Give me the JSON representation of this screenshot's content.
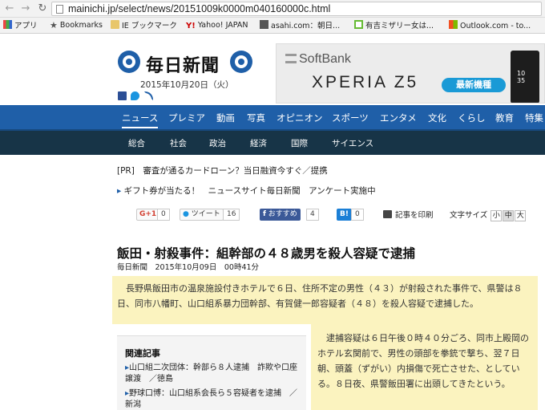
{
  "browser": {
    "url": "mainichi.jp/select/news/20151009k0000m040160000c.html",
    "bookmarks": [
      {
        "icon": "apps-icon",
        "label": "アプリ"
      },
      {
        "icon": "star-icon",
        "label": "Bookmarks"
      },
      {
        "icon": "folder-icon",
        "label": "IE ブックマーク"
      },
      {
        "icon": "yahoo-icon",
        "label": "Yahoo! JAPAN"
      },
      {
        "icon": "asahi-icon",
        "label": "asahi.com：朝日..."
      },
      {
        "icon": "green-icon",
        "label": "有吉ミザリー女は..."
      },
      {
        "icon": "microsoft-icon",
        "label": "Outlook.com - to..."
      }
    ]
  },
  "header": {
    "logo_text": "毎日新聞",
    "date": "2015年10月20日（火）"
  },
  "ad": {
    "brand": "SoftBank",
    "model": "XPERIA Z5",
    "badge": "最新機種",
    "phone_time": "10\n35"
  },
  "nav_primary": [
    "ニュース",
    "プレミア",
    "動画",
    "写真",
    "オピニオン",
    "スポーツ",
    "エンタメ",
    "文化",
    "くらし",
    "教育",
    "特集"
  ],
  "nav_secondary": [
    "総合",
    "社会",
    "政治",
    "経済",
    "国際",
    "サイエンス"
  ],
  "promos": {
    "pr_line": "[PR]　審査が通るカードローン？当日融資今すぐ／提携",
    "survey_line": "ギフト券が当たる！　ニュースサイト毎日新聞　アンケート実施中",
    "survey_arrow": "▸"
  },
  "share": {
    "gplus_label": "G+1",
    "gplus_count": "0",
    "tweet_label": "ツイート",
    "tweet_count": "16",
    "fb_label": "おすすめ",
    "fb_count": "4",
    "hatena_label": "B!",
    "hatena_count": "0",
    "print_label": "記事を印刷",
    "font_size_label": "文字サイズ",
    "font_sizes": [
      "小",
      "中",
      "大"
    ]
  },
  "article": {
    "headline": "飯田・射殺事件：組幹部の４８歳男を殺人容疑で逮捕",
    "byline": "毎日新聞　2015年10月09日　00時41分",
    "lead": "長野県飯田市の温泉施設付きホテルで６日、住所不定の男性（４３）が射殺された事件で、県警は８日、同市八幡町、山口組系暴力団幹部、有賀健一郎容疑者（４８）を殺人容疑で逮捕した。",
    "body": "逮捕容疑は６日午後０時４０分ごろ、同市上殿岡のホテル玄関前で、男性の頭部を拳銃で撃ち、翌７日朝、頭蓋（ずがい）内損傷で死亡させた、としている。８日夜、県警飯田署に出頭してきたという。"
  },
  "related": {
    "title": "関連記事",
    "links": [
      "山口組二次団体：幹部ら８人逮捕　詐欺や口座譲渡　／徳島",
      "野球口博：山口組系会長ら５容疑者を逮捕　／新潟"
    ]
  }
}
